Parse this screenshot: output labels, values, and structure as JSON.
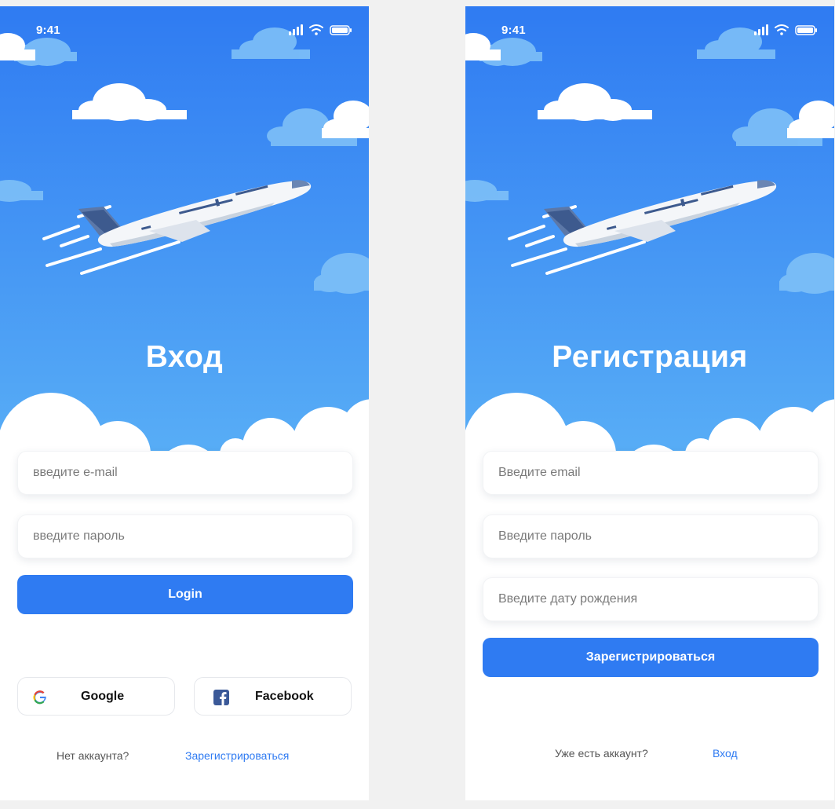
{
  "status_bar": {
    "time": "9:41"
  },
  "login": {
    "title": "Вход",
    "email_placeholder": "введите e-mail",
    "password_placeholder": "введите пароль",
    "login_button": "Login",
    "google_button": "Google",
    "facebook_button": "Facebook",
    "no_account_text": "Нет аккаунта?",
    "register_link": "Зарегистрироваться"
  },
  "register": {
    "title": "Регистрация",
    "email_placeholder": "Введите email",
    "password_placeholder": "Введите пароль",
    "birthdate_placeholder": "Введите дату рождения",
    "register_button": "Зарегистрироваться",
    "have_account_text": "Уже есть аккаунт?",
    "login_link": "Вход"
  },
  "icons": [
    "signal-icon",
    "wifi-icon",
    "battery-icon",
    "airplane-illustration",
    "cloud-icon",
    "google-icon",
    "facebook-icon"
  ],
  "colors": {
    "sky_top": "#2f7bf2",
    "sky_bottom": "#56aef6",
    "accent": "#2f7bf2"
  }
}
